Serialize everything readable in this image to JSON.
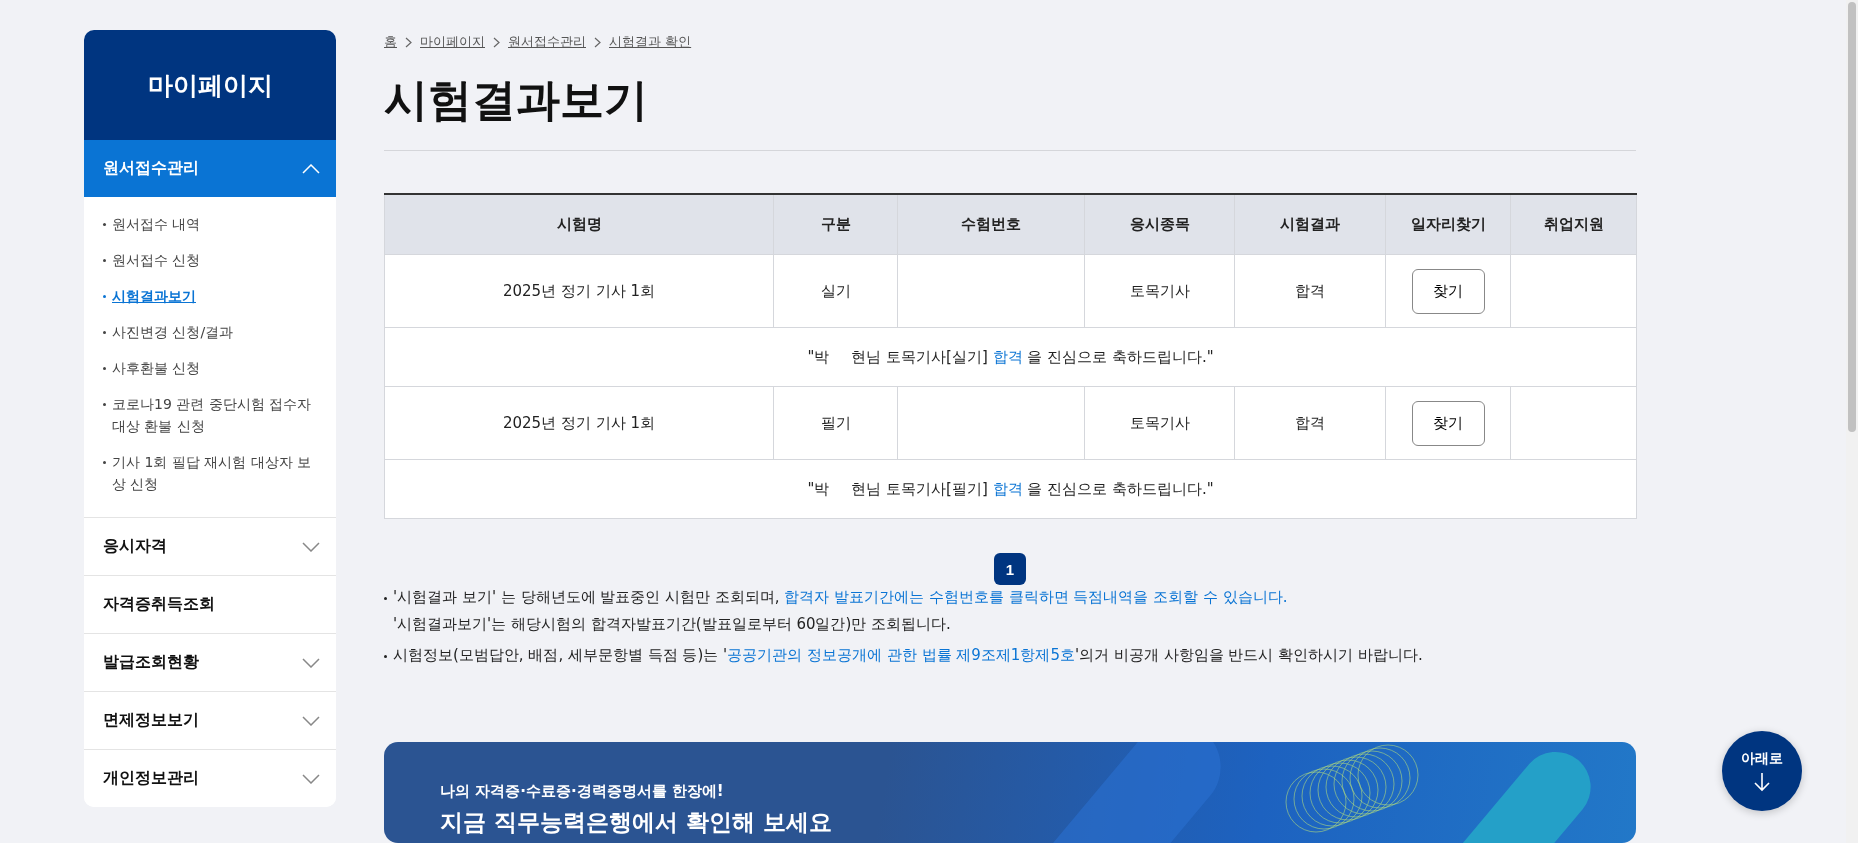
{
  "sidebar": {
    "title": "마이페이지",
    "sections": [
      {
        "label": "원서접수관리",
        "expanded": true,
        "has_toggle": true,
        "children": [
          {
            "label": "원서접수 내역",
            "selected": false
          },
          {
            "label": "원서접수 신청",
            "selected": false
          },
          {
            "label": "시험결과보기",
            "selected": true
          },
          {
            "label": "사진변경 신청/결과",
            "selected": false
          },
          {
            "label": "사후환불 신청",
            "selected": false
          },
          {
            "label": "코로나19 관련 중단시험 접수자 대상 환불 신청",
            "selected": false
          },
          {
            "label": "기사 1회 필답 재시험 대상자 보상 신청",
            "selected": false
          }
        ]
      },
      {
        "label": "응시자격",
        "expanded": false,
        "has_toggle": true
      },
      {
        "label": "자격증취득조회",
        "expanded": false,
        "has_toggle": false
      },
      {
        "label": "발급조회현황",
        "expanded": false,
        "has_toggle": true
      },
      {
        "label": "면제정보보기",
        "expanded": false,
        "has_toggle": true
      },
      {
        "label": "개인정보관리",
        "expanded": false,
        "has_toggle": true
      }
    ]
  },
  "breadcrumb": [
    "홈",
    "마이페이지",
    "원서접수관리",
    "시험결과 확인"
  ],
  "page_title": "시험결과보기",
  "table": {
    "columns": [
      "시험명",
      "구분",
      "수험번호",
      "응시종목",
      "시험결과",
      "일자리찾기",
      "취업지원"
    ],
    "rows": [
      {
        "exam": "2025년 정기 기사 1회",
        "type": "실기",
        "subject": "토목기사",
        "result": "합격",
        "button": "찾기",
        "message": {
          "before": "\"박",
          "name_rest": "현님 토목기사[실기] ",
          "highlight": "합격",
          "after": " 을 진심으로 축하드립니다.\""
        }
      },
      {
        "exam": "2025년 정기 기사 1회",
        "type": "필기",
        "subject": "토목기사",
        "result": "합격",
        "button": "찾기",
        "message": {
          "before": "\"박",
          "name_rest": "현님 토목기사[필기] ",
          "highlight": "합격",
          "after": " 을 진심으로 축하드립니다.\""
        }
      }
    ]
  },
  "pagination": [
    {
      "label": "1",
      "selected": true
    }
  ],
  "notes": [
    {
      "lines": [
        [
          {
            "kind": "plain",
            "text": "'시험결과 보기' 는 당해년도에 발표중인 시험만 조회되며, "
          },
          {
            "kind": "link",
            "text": "합격자 발표기간에는 수험번호를 클릭하면 득점내역을 조회할 수 있습니다."
          }
        ],
        [
          {
            "kind": "plain",
            "text": "'시험결과보기'는 해당시험의 합격자발표기간(발표일로부터 60일간)만 조회됩니다."
          }
        ]
      ]
    },
    {
      "lines": [
        [
          {
            "kind": "plain",
            "text": "시험정보(모범답안, 배점, 세부문항별 득점 등)는 '"
          },
          {
            "kind": "link",
            "text": "공공기관의 정보공개에 관한 법률 제9조제1항제5호"
          },
          {
            "kind": "plain",
            "text": "'의거 비공개 사항임을 반드시 확인하시기 바랍니다."
          }
        ]
      ]
    }
  ],
  "banner": {
    "subtitle": "나의 자격증·수료증·경력증명서를 한장에!",
    "title": "지금 직무능력은행에서 확인해 보세요"
  },
  "scroll_button": {
    "label": "아래로"
  }
}
